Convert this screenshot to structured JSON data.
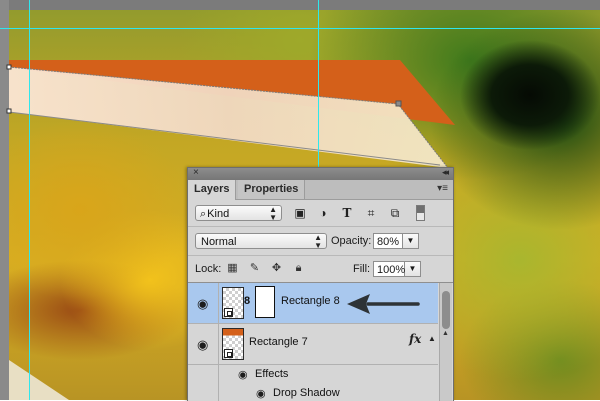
{
  "canvas": {
    "colors": {
      "guide": "#2ee7ee",
      "shape_orange": "#d4601a",
      "shape_cream": "#f6e6cf",
      "selection_highlight": "#a9c8ee"
    }
  },
  "panel": {
    "close_icon": "×",
    "collapse_icon": "◂◂",
    "menu_icon": "▾≡",
    "tabs": [
      {
        "label": "Layers",
        "active": true
      },
      {
        "label": "Properties",
        "active": false
      }
    ],
    "filter": {
      "kind_label": "Kind",
      "icons": [
        "image-filter-icon",
        "adjustment-filter-icon",
        "type-filter-icon",
        "shape-filter-icon",
        "smart-object-filter-icon"
      ]
    },
    "blend_mode": "Normal",
    "opacity_label": "Opacity:",
    "opacity_value": "80%",
    "lock_label": "Lock:",
    "lock_icons": [
      "lock-transparent-icon",
      "lock-paint-icon",
      "lock-position-icon",
      "lock-all-icon"
    ],
    "fill_label": "Fill:",
    "fill_value": "100%"
  },
  "layers": [
    {
      "name": "Rectangle 8",
      "selected": true,
      "has_mask": true
    },
    {
      "name": "Rectangle 7",
      "selected": false,
      "has_fx": true,
      "fx_label": "fx"
    }
  ],
  "effects": {
    "header": "Effects",
    "items": [
      "Drop Shadow"
    ]
  }
}
